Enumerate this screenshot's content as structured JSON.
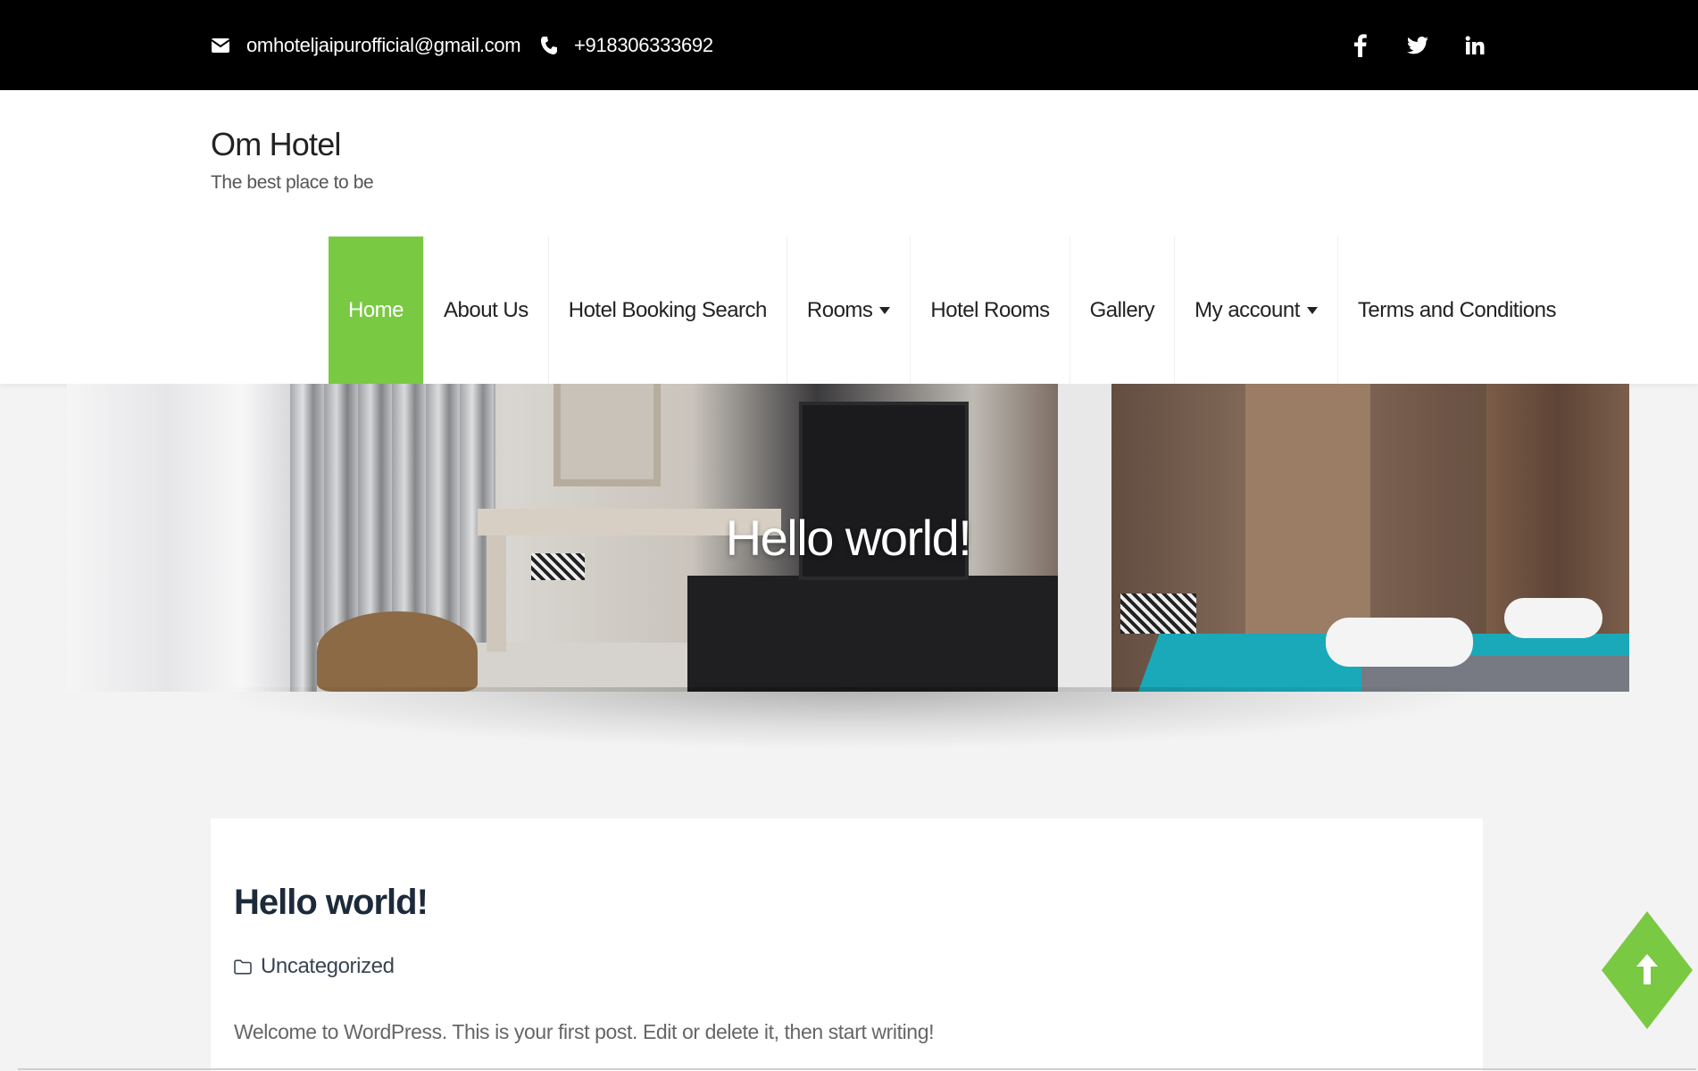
{
  "topbar": {
    "email": "omhoteljaipurofficial@gmail.com",
    "phone": "+918306333692",
    "icons": [
      "envelope-icon",
      "phone-icon",
      "facebook-icon",
      "twitter-icon",
      "linkedin-icon"
    ]
  },
  "site": {
    "title": "Om Hotel",
    "tagline": "The best place to be"
  },
  "nav": {
    "items": [
      {
        "label": "Home",
        "active": true
      },
      {
        "label": "About Us"
      },
      {
        "label": "Hotel Booking Search"
      },
      {
        "label": "Rooms",
        "dropdown": true
      },
      {
        "label": "Hotel Rooms"
      },
      {
        "label": "Gallery"
      },
      {
        "label": "My account",
        "dropdown": true
      },
      {
        "label": "Terms and Conditions"
      }
    ]
  },
  "banner": {
    "title": "Hello world!"
  },
  "post": {
    "title": "Hello world!",
    "category": "Uncategorized",
    "excerpt": "Welcome to WordPress. This is your first post. Edit or delete it, then start writing!"
  },
  "colors": {
    "accent": "#7ac943",
    "topbar_bg": "#000000",
    "page_bg": "#f3f3f3"
  }
}
